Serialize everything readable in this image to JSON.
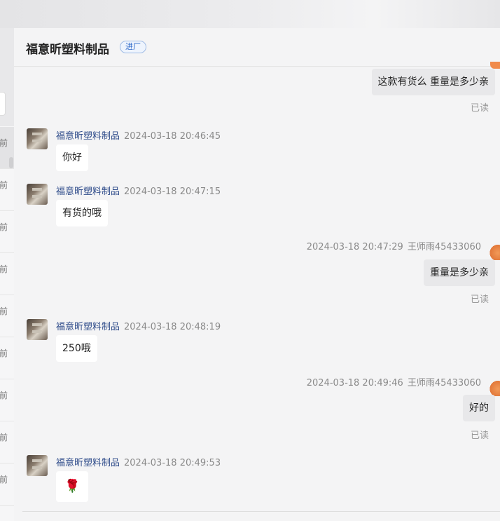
{
  "header": {
    "title": "福意昕塑料制品",
    "tag": "进厂"
  },
  "left_list": {
    "items": [
      "前",
      "前",
      "前",
      "前",
      "前",
      "前",
      "前",
      "前",
      "前"
    ]
  },
  "messages": {
    "m1": {
      "text": "这款有货么 重量是多少亲",
      "read": "已读"
    },
    "m2": {
      "sender": "福意昕塑料制品",
      "time": "2024-03-18 20:46:45",
      "text": "你好"
    },
    "m3": {
      "sender": "福意昕塑料制品",
      "time": "2024-03-18 20:47:15",
      "text": "有货的哦"
    },
    "m4": {
      "time": "2024-03-18 20:47:29",
      "sender": "王师雨45433060",
      "text": "重量是多少亲",
      "read": "已读"
    },
    "m5": {
      "sender": "福意昕塑料制品",
      "time": "2024-03-18 20:48:19",
      "text": "250哦"
    },
    "m6": {
      "time": "2024-03-18 20:49:46",
      "sender": "王师雨45433060",
      "text": "好的",
      "read": "已读"
    },
    "m7": {
      "sender": "福意昕塑料制品",
      "time": "2024-03-18 20:49:53",
      "emoji": "🌹"
    }
  }
}
